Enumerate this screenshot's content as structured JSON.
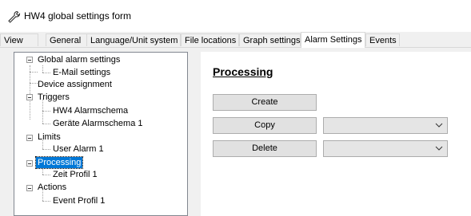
{
  "window": {
    "title": "HW4 global settings form"
  },
  "tabs": [
    {
      "label": "View"
    },
    {
      "label": "General"
    },
    {
      "label": "Language/Unit system"
    },
    {
      "label": "File locations"
    },
    {
      "label": "Graph settings"
    },
    {
      "label": "Alarm Settings",
      "active": true
    },
    {
      "label": "Events"
    }
  ],
  "tree": {
    "items": [
      {
        "label": "Global alarm settings",
        "expanded": true
      },
      {
        "label": "E-Mail settings"
      },
      {
        "label": "Device assignment"
      },
      {
        "label": "Triggers",
        "expanded": true
      },
      {
        "label": "HW4 Alarmschema"
      },
      {
        "label": "Geräte Alarmschema 1"
      },
      {
        "label": "Limits",
        "expanded": true
      },
      {
        "label": "User Alarm 1"
      },
      {
        "label": "Processing",
        "expanded": true,
        "selected": true
      },
      {
        "label": "Zeit Profil 1"
      },
      {
        "label": "Actions",
        "expanded": true
      },
      {
        "label": "Event Profil 1"
      }
    ]
  },
  "panel": {
    "heading": "Processing",
    "create_label": "Create",
    "copy_label": "Copy",
    "delete_label": "Delete",
    "copy_select_value": "",
    "delete_select_value": ""
  }
}
